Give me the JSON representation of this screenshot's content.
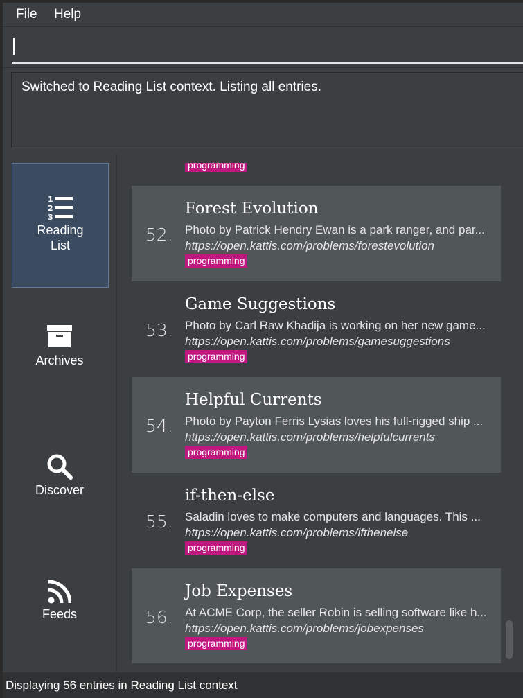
{
  "menu": {
    "file": "File",
    "help": "Help"
  },
  "command": {
    "value": ""
  },
  "result": {
    "message": "Switched to Reading List context. Listing all entries."
  },
  "sidebar": {
    "items": [
      {
        "label_line1": "Reading",
        "label_line2": "List",
        "icon": "numbered-list-icon",
        "active": true
      },
      {
        "label": "Archives",
        "icon": "archive-box-icon",
        "active": false
      },
      {
        "label": "Discover",
        "icon": "search-icon",
        "active": false
      },
      {
        "label": "Feeds",
        "icon": "rss-icon",
        "active": false
      }
    ]
  },
  "list": {
    "partial_tag": "programming",
    "entries": [
      {
        "index": "52.",
        "title": "Forest Evolution",
        "description": "Photo by Patrick Hendry Ewan is a park ranger, and par...",
        "link": "https://open.kattis.com/problems/forestevolution",
        "tag": "programming"
      },
      {
        "index": "53.",
        "title": "Game Suggestions",
        "description": "Photo by Carl Raw Khadija is working on her new game...",
        "link": "https://open.kattis.com/problems/gamesuggestions",
        "tag": "programming"
      },
      {
        "index": "54.",
        "title": "Helpful Currents",
        "description": "Photo by Payton Ferris Lysias loves his full-rigged ship ...",
        "link": "https://open.kattis.com/problems/helpfulcurrents",
        "tag": "programming"
      },
      {
        "index": "55.",
        "title": "if-then-else",
        "description": "Saladin loves to make computers and languages. This ...",
        "link": "https://open.kattis.com/problems/ifthenelse",
        "tag": "programming"
      },
      {
        "index": "56.",
        "title": "Job Expenses",
        "description": "At ACME Corp, the seller Robin is selling software like h...",
        "link": "https://open.kattis.com/problems/jobexpenses",
        "tag": "programming"
      }
    ]
  },
  "status": {
    "text": "Displaying 56 entries in Reading List context"
  },
  "colors": {
    "background": "#3c3f41",
    "card_alt": "#515658",
    "tag": "#c0187f",
    "active_tab": "#3b4b60"
  }
}
